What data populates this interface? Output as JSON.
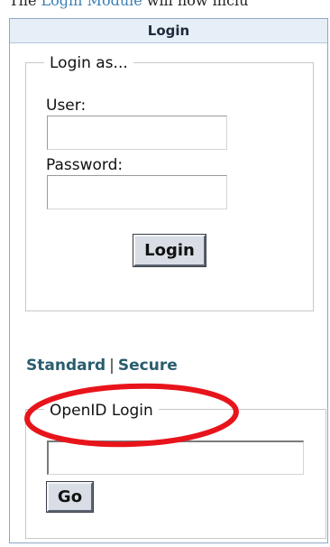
{
  "top_text": {
    "prefix": "The",
    "link": "Login Module",
    "suffix": "will now inclu"
  },
  "login_module": {
    "title": "Login",
    "login_as": {
      "legend": "Login as...",
      "user_label": "User:",
      "password_label": "Password:",
      "user_value": "",
      "password_value": "",
      "submit_label": "Login"
    },
    "links": {
      "standard": "Standard",
      "separator": "|",
      "secure": "Secure"
    },
    "openid": {
      "legend": "OpenID Login",
      "input_value": "",
      "submit_label": "Go"
    }
  },
  "colors": {
    "highlight": "#e8141b",
    "header_bg": "#e6eef8",
    "link": "#2a5d6e"
  }
}
